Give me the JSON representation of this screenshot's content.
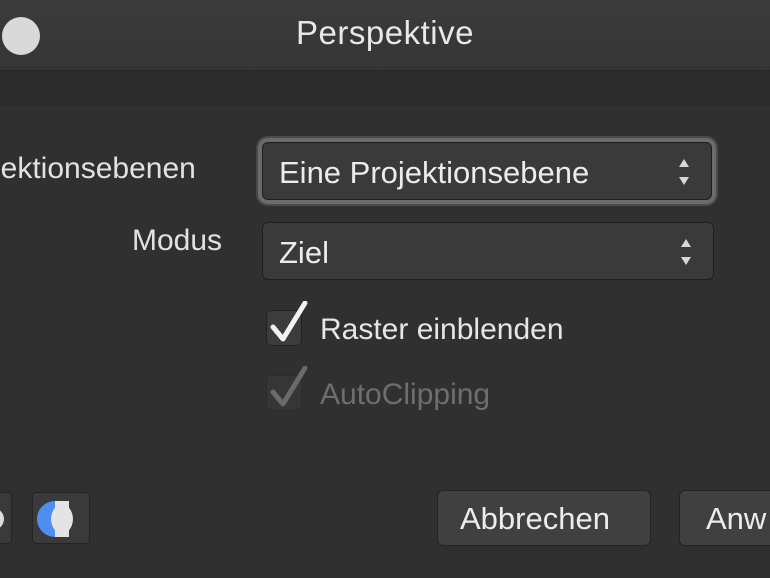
{
  "window": {
    "title": "Perspektive"
  },
  "form": {
    "planes_label": "jektionsebenen",
    "planes_value": "Eine Projektionsebene",
    "mode_label": "Modus",
    "mode_value": "Ziel",
    "show_grid_label": "Raster einblenden",
    "show_grid_checked": true,
    "autoclip_label": "AutoClipping",
    "autoclip_checked": true,
    "autoclip_enabled": false
  },
  "buttons": {
    "cancel": "Abbrechen",
    "apply": "Anw"
  },
  "icons": {
    "left_toggle": "circle-toggle-icon",
    "split_view": "split-view-icon"
  },
  "colors": {
    "background": "#2f2f2f",
    "titlebar": "#383838",
    "accent": "#4d8ef0",
    "text": "#e6e6e6"
  }
}
